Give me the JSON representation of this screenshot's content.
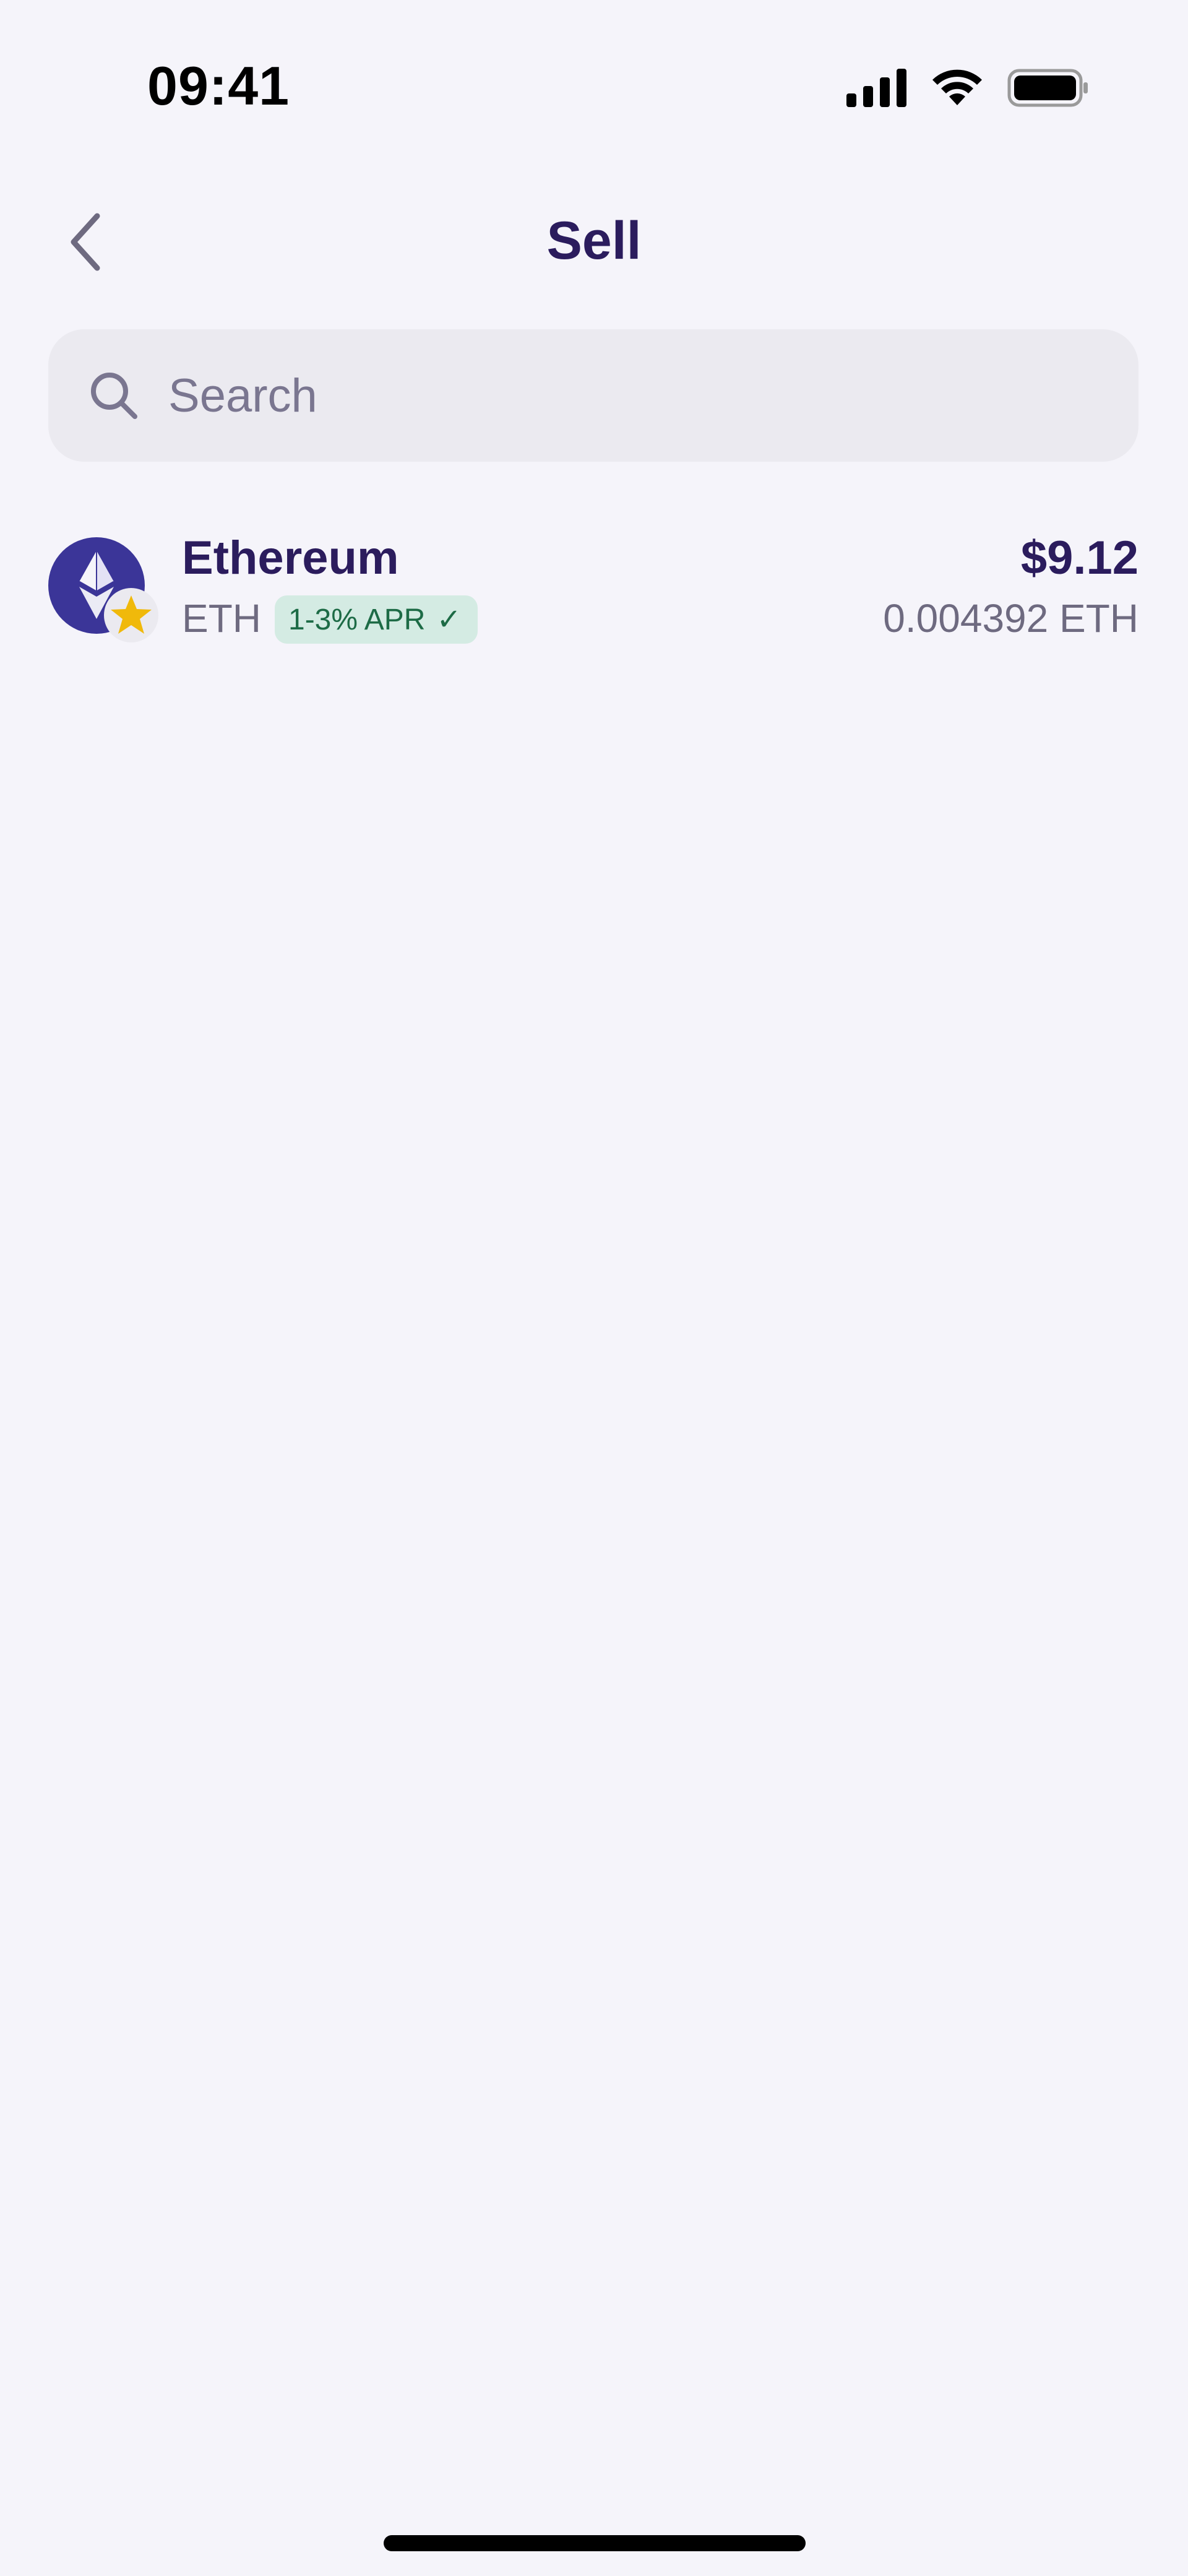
{
  "status_bar": {
    "time": "09:41",
    "icons": [
      "signal-icon",
      "wifi-icon",
      "battery-icon"
    ]
  },
  "header": {
    "title": "Sell",
    "back_icon": "chevron-left-icon"
  },
  "search": {
    "placeholder": "Search",
    "value": "",
    "icon": "search-icon"
  },
  "assets": [
    {
      "name": "Ethereum",
      "symbol": "ETH",
      "badge": {
        "label": "1-3% APR",
        "check": "✓"
      },
      "fiat_value": "$9.12",
      "amount": "0.004392 ETH",
      "icon": "ethereum-icon",
      "overlay_icon": "star-icon"
    }
  ],
  "colors": {
    "background": "#f5f4fa",
    "title": "#2b1c5d",
    "secondary_text": "#6e6a80",
    "search_bg": "#ebeaf0",
    "eth_circle": "#3b3598",
    "badge_bg": "#d4ebe3",
    "badge_text": "#1d6b46",
    "star": "#f0b90b"
  }
}
